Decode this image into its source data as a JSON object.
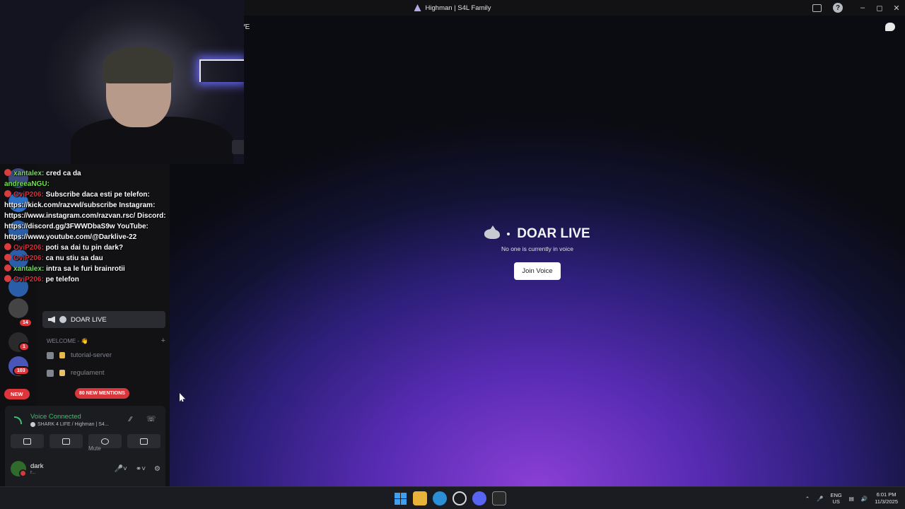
{
  "window": {
    "title": "Highman | S4L Family"
  },
  "stage": {
    "channel_name": "DOAR LIVE",
    "status_text": "No one is currently in voice",
    "join_label": "Join Voice",
    "header_fragment": "VE"
  },
  "sidebar": {
    "active_channel": "DOAR LIVE",
    "category": "WELCOME - 👋",
    "channels": [
      {
        "label": "tutorial-server"
      },
      {
        "label": "regulament"
      }
    ],
    "mentions_pill": "80 NEW MENTIONS",
    "new_pill": "NEW",
    "server_badges": [
      "14",
      "1",
      "103"
    ]
  },
  "voice_panel": {
    "status": "Voice Connected",
    "location": "SHARK 4 LIFE / Highman | S4...",
    "mute_tooltip": "Mute",
    "user_name": "dark",
    "user_status": "r..."
  },
  "stream_chat": [
    {
      "user": "xantalex:",
      "text": "cred ca da",
      "color_class": "u1"
    },
    {
      "user": "andreeaNGU:",
      "text": "",
      "color_class": "u3"
    },
    {
      "user": "OviP206:",
      "text": "Subscribe daca esti pe telefon: https://kick.com/razvwl/subscribe Instagram: https://www.instagram.com/razvan.rsc/ Discord: https://discord.gg/3FWWDbaS9w YouTube: https://www.youtube.com/@Darklive-22",
      "color_class": "u2"
    },
    {
      "user": "OviP206:",
      "text": "poti sa dai tu pin dark?",
      "color_class": "u2"
    },
    {
      "user": "OviP206:",
      "text": "ca nu stiu sa dau",
      "color_class": "u2"
    },
    {
      "user": "xantalex:",
      "text": "intra sa le furi brainrotii",
      "color_class": "u1"
    },
    {
      "user": "OviP206:",
      "text": "pe telefon",
      "color_class": "u2"
    }
  ],
  "taskbar": {
    "lang_top": "ENG",
    "lang_bottom": "US",
    "time": "6:01 PM",
    "date": "11/3/2025"
  }
}
